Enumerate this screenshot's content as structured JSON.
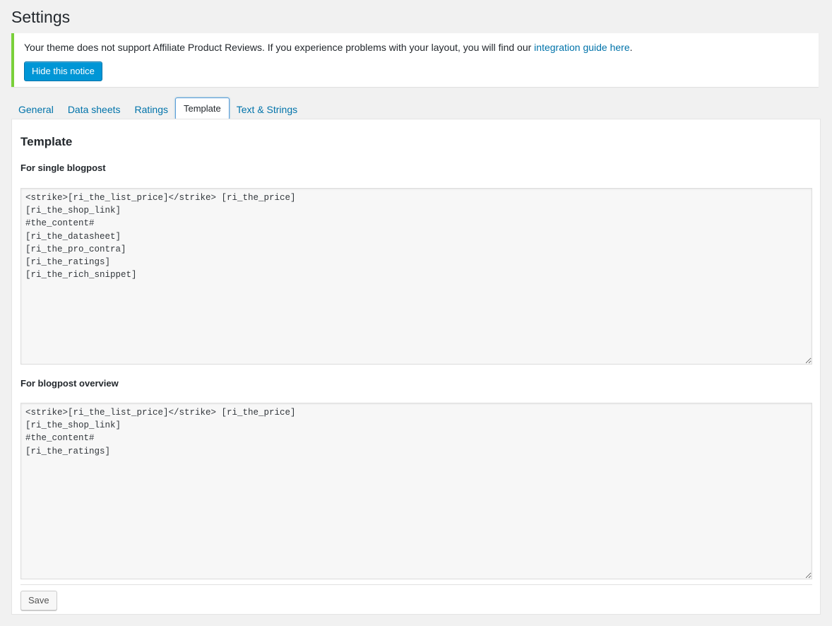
{
  "page": {
    "title": "Settings"
  },
  "notice": {
    "text_before": "Your theme does not support Affiliate Product Reviews. If you experience problems with your layout, you will find our ",
    "link_text": "integration guide here",
    "text_after": ".",
    "button_label": "Hide this notice",
    "accent_color": "#7ad03a"
  },
  "tabs": [
    {
      "label": "General",
      "active": false
    },
    {
      "label": "Data sheets",
      "active": false
    },
    {
      "label": "Ratings",
      "active": false
    },
    {
      "label": "Template",
      "active": true
    },
    {
      "label": "Text & Strings",
      "active": false
    }
  ],
  "template": {
    "heading": "Template",
    "single": {
      "label": "For single blogpost",
      "value": "<strike>[ri_the_list_price]</strike> [ri_the_price]\n[ri_the_shop_link]\n#the_content#\n[ri_the_datasheet]\n[ri_the_pro_contra]\n[ri_the_ratings]\n[ri_the_rich_snippet]"
    },
    "overview": {
      "label": "For blogpost overview",
      "value": "<strike>[ri_the_list_price]</strike> [ri_the_price]\n[ri_the_shop_link]\n#the_content#\n[ri_the_ratings]"
    },
    "save_label": "Save"
  },
  "colors": {
    "link": "#0073aa",
    "primary_button": "#0096d6",
    "background": "#f1f1f1"
  }
}
